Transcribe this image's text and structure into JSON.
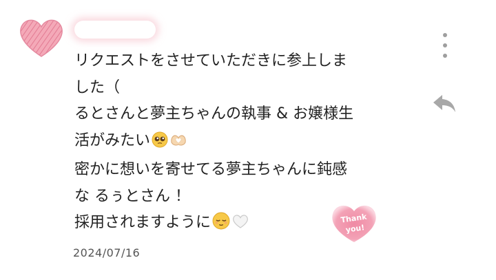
{
  "post": {
    "lines": [
      "リクエストをさせていただきに参上しま",
      "した（",
      "るとさんと夢主ちゃんの執事 & お嬢様生",
      "活がみたい",
      "密かに想いを寄せてる夢主ちゃんに鈍感",
      "な るぅとさん ！",
      "採用されますように"
    ],
    "date": "2024/07/16"
  },
  "sticker": {
    "line1": "Thank",
    "line2": "you!"
  },
  "icons": {
    "avatar": "pink-heart-avatar-icon",
    "menu": "more-vertical-icon",
    "reply": "reply-arrow-icon",
    "emoji_1": "pleading-face-emoji-icon",
    "emoji_2": "heart-hands-emoji-icon",
    "emoji_3": "relieved-face-emoji-icon",
    "emoji_4": "white-heart-emoji-icon"
  },
  "colors": {
    "accent_pink": "#e97a96",
    "text": "#222222",
    "icon_gray": "#9e9e9e"
  }
}
